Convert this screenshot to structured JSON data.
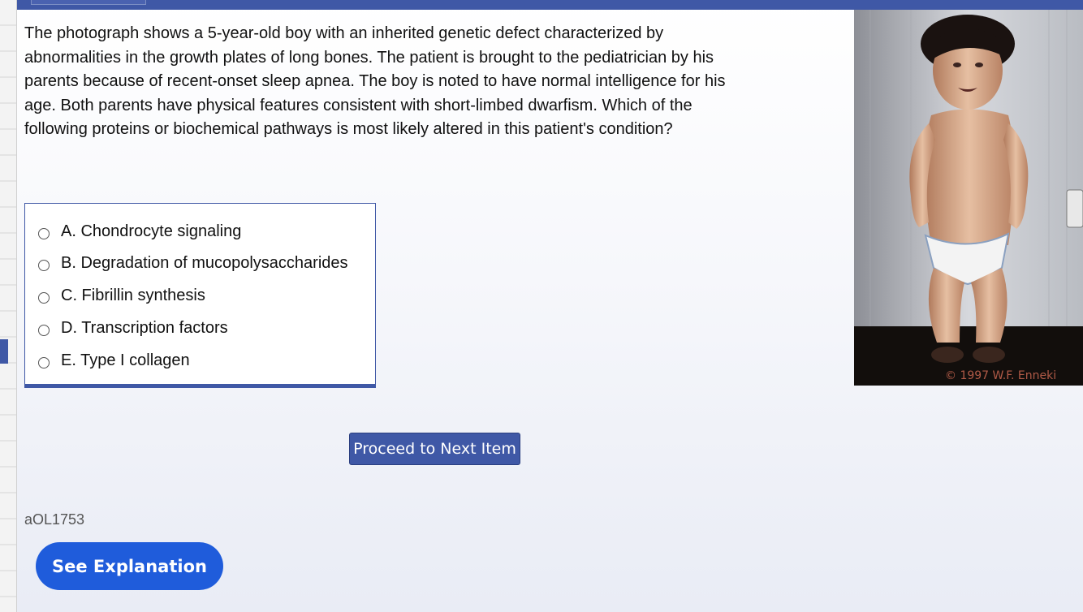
{
  "question": {
    "stem": "The photograph shows a 5-year-old boy with an inherited genetic defect characterized by abnormalities in the growth plates of long bones. The patient is brought to the pediatrician by his parents because of recent-onset sleep apnea. The boy is noted to have normal intelligence for his age. Both parents have physical features consistent with short-limbed dwarfism. Which of the following proteins or biochemical pathways is most likely altered in this patient's condition?",
    "choices": [
      {
        "label": "A. Chondrocyte signaling"
      },
      {
        "label": "B. Degradation of mucopolysaccharides"
      },
      {
        "label": "C. Fibrillin synthesis"
      },
      {
        "label": "D. Transcription factors"
      },
      {
        "label": "E. Type I collagen"
      }
    ],
    "id": "aOL1753"
  },
  "image": {
    "copyright": "© 1997 W.F. Enneki"
  },
  "buttons": {
    "proceed_label": "Proceed to Next Item",
    "explanation_label": "See Explanation"
  },
  "colors": {
    "accent": "#3f58a6",
    "explanation_button": "#1f5cdb"
  }
}
